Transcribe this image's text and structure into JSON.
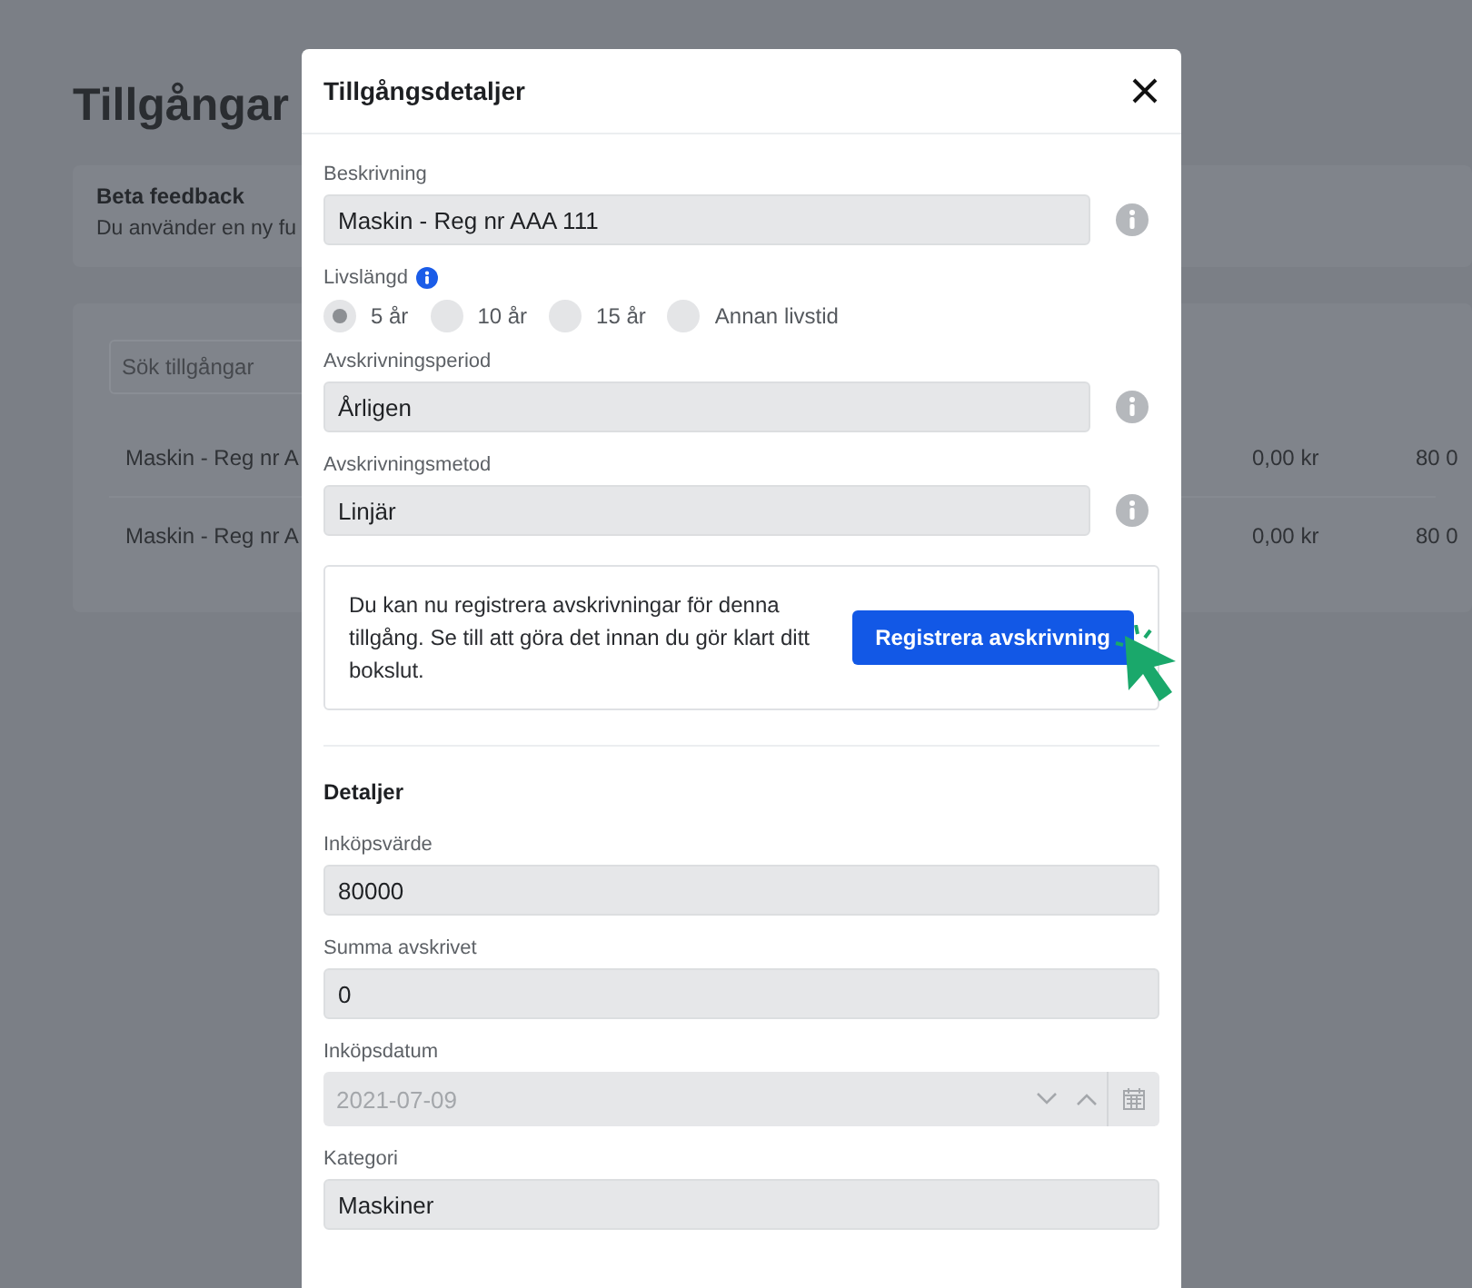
{
  "page": {
    "title": "Tillgångar",
    "beta": {
      "title": "Beta feedback",
      "text": "Du använder en ny fu"
    },
    "search": {
      "placeholder": "Sök tillgångar"
    },
    "rows": [
      {
        "name": "Maskin - Reg nr A",
        "column_2": "0,00 kr",
        "column_3": "80 0"
      },
      {
        "name": "Maskin - Reg nr A",
        "column_2": "0,00 kr",
        "column_3": "80 0"
      }
    ]
  },
  "dialog": {
    "title": "Tillgångsdetaljer",
    "top_fields": [
      {
        "kind": "text",
        "label": "Beskrivning",
        "value": "Maskin - Reg nr AAA 111"
      },
      {
        "kind": "radio",
        "label": "Livslängd",
        "options": [
          {
            "label": "5 år",
            "selected": true
          },
          {
            "label": "10 år",
            "selected": false
          },
          {
            "label": "15 år",
            "selected": false
          },
          {
            "label": "Annan livstid",
            "selected": false
          }
        ]
      },
      {
        "kind": "text",
        "label": "Avskrivningsperiod",
        "value": "Årligen"
      },
      {
        "kind": "text",
        "label": "Avskrivningsmetod",
        "value": "Linjär"
      }
    ],
    "notice": {
      "text": "Du kan nu registrera avskrivningar för denna tillgång. Se till att göra det innan du gör klart ditt bokslut.",
      "button": "Registrera avskrivning"
    },
    "details": {
      "heading": "Detaljer",
      "fields": [
        {
          "kind": "text",
          "label": "Inköpsvärde",
          "value": "80000"
        },
        {
          "kind": "text",
          "label": "Summa avskrivet",
          "value": "0"
        },
        {
          "kind": "date",
          "label": "Inköpsdatum",
          "value": "2021-07-09",
          "disabled": true
        },
        {
          "kind": "text",
          "label": "Kategori",
          "value": "Maskiner"
        }
      ]
    }
  }
}
